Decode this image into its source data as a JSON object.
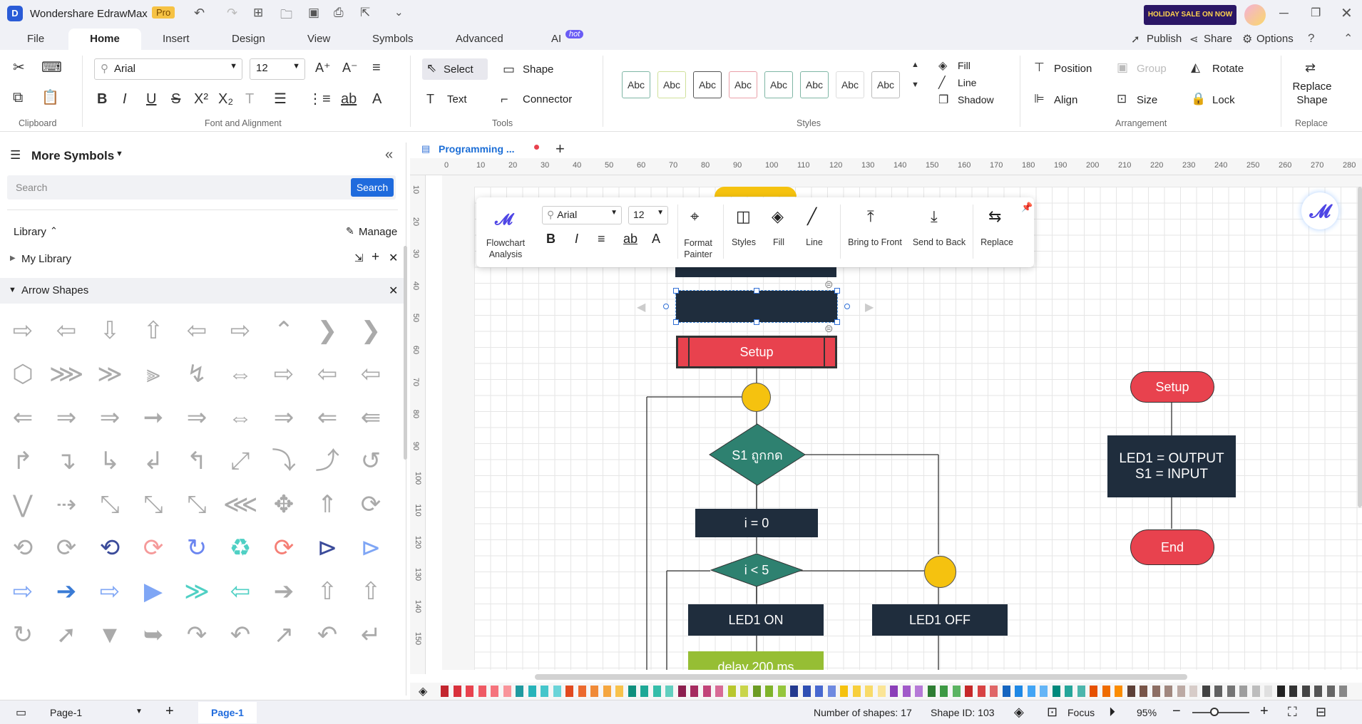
{
  "app": {
    "name": "Wondershare EdrawMax",
    "badge": "Pro",
    "promo": "HOLIDAY SALE ON NOW"
  },
  "menu": {
    "tabs": [
      "File",
      "Home",
      "Insert",
      "Design",
      "View",
      "Symbols",
      "Advanced",
      "AI"
    ],
    "ai_badge": "hot",
    "right": [
      "Publish",
      "Share",
      "Options"
    ]
  },
  "ribbon": {
    "font": "Arial",
    "size": "12",
    "tools": {
      "select": "Select",
      "shape": "Shape",
      "text": "Text",
      "connector": "Connector"
    },
    "style_sample": "Abc",
    "fill": "Fill",
    "line": "Line",
    "shadow": "Shadow",
    "arrangement": {
      "position": "Position",
      "group": "Group",
      "rotate": "Rotate",
      "align": "Align",
      "size": "Size",
      "lock": "Lock"
    },
    "replace": "Replace Shape",
    "groups": [
      "Clipboard",
      "Font and Alignment",
      "Tools",
      "Styles",
      "Arrangement",
      "Replace"
    ]
  },
  "doc_tab": "Programming ...",
  "left": {
    "title": "More Symbols",
    "search_placeholder": "Search",
    "search_btn": "Search",
    "library": "Library",
    "manage": "Manage",
    "my_library": "My Library",
    "section": "Arrow Shapes"
  },
  "ruler_h": [
    "0",
    "10",
    "20",
    "30",
    "40",
    "50",
    "60",
    "70",
    "80",
    "90",
    "100",
    "110",
    "120",
    "130",
    "140",
    "150",
    "160",
    "170",
    "180",
    "190",
    "200",
    "210",
    "220",
    "230",
    "240",
    "250",
    "260",
    "270",
    "280"
  ],
  "ruler_v": [
    "10",
    "20",
    "30",
    "40",
    "50",
    "60",
    "70",
    "80",
    "90",
    "100",
    "110",
    "120",
    "130",
    "140",
    "150"
  ],
  "floatbar": {
    "font": "Arial",
    "size": "12",
    "items": [
      "Flowchart Analysis",
      "Format Painter",
      "Styles",
      "Fill",
      "Line",
      "Bring to Front",
      "Send to Back",
      "Replace"
    ]
  },
  "flow": {
    "setup_main": "Setup",
    "s1": "S1 ถูกกด",
    "i0": "i = 0",
    "ilt5": "i < 5",
    "led_on": "LED1 ON",
    "led_off": "LED1 OFF",
    "delay": "delay 200 ms",
    "right_setup": "Setup",
    "right_out": "LED1 = OUTPUT",
    "right_in": "S1 = INPUT",
    "right_end": "End"
  },
  "status": {
    "page": "Page-1",
    "page_tab": "Page-1",
    "shapes": "Number of shapes: 17",
    "shape_id": "Shape ID: 103",
    "focus": "Focus",
    "zoom": "95%"
  }
}
